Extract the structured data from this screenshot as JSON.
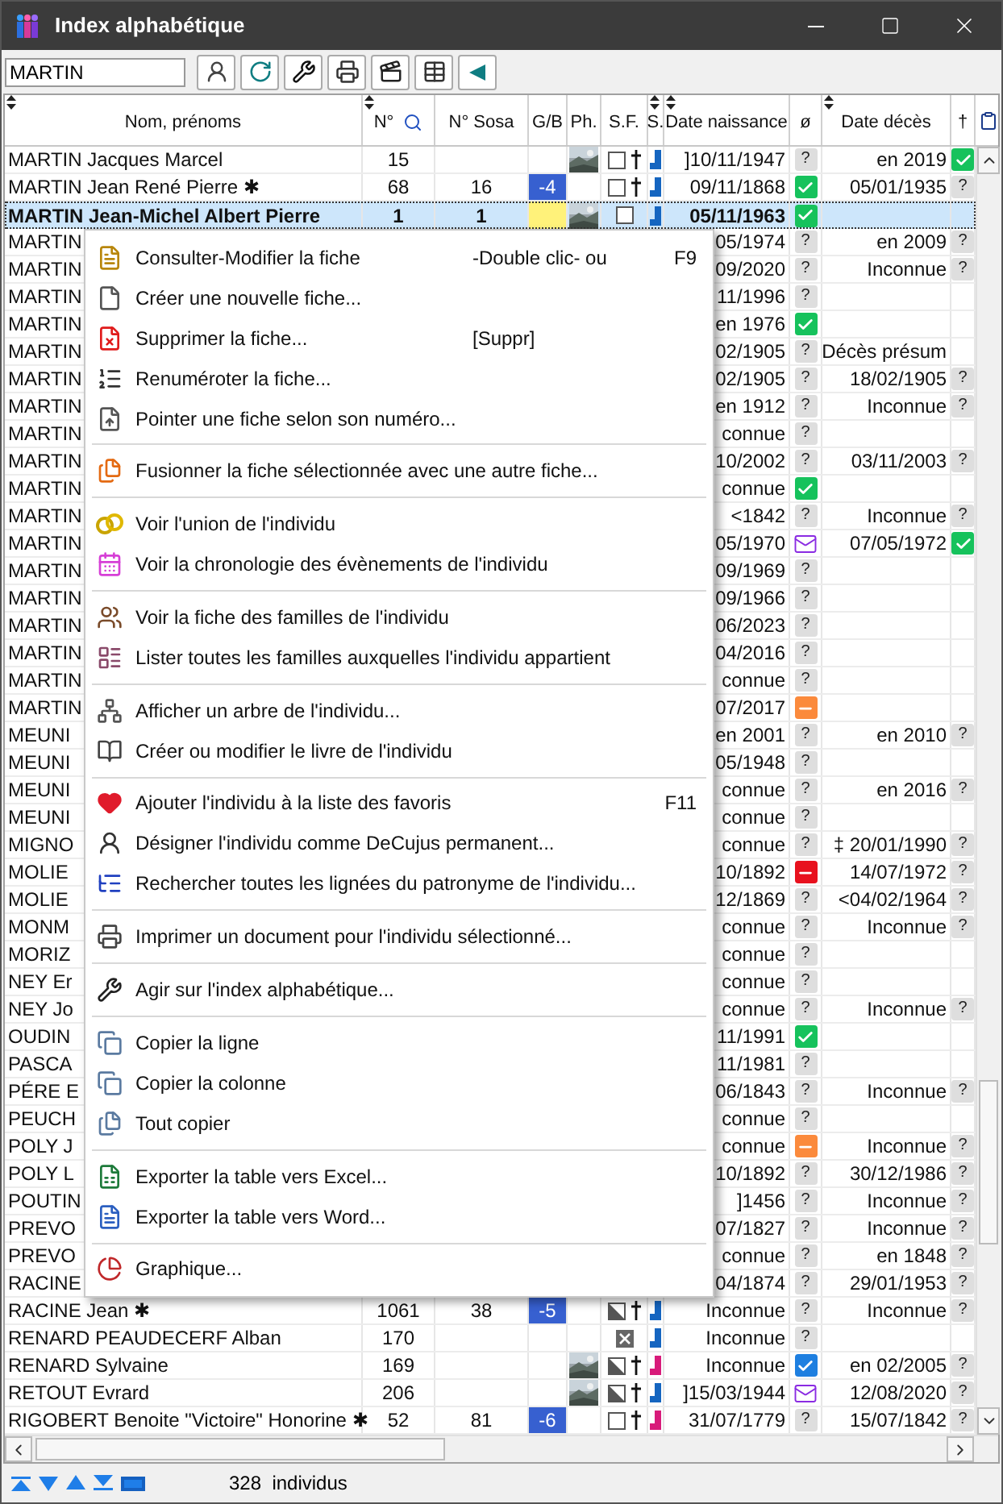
{
  "window": {
    "title": "Index alphabétique"
  },
  "toolbar": {
    "search": {
      "value": "MARTIN"
    }
  },
  "table": {
    "columns": [
      {
        "label": "Nom, prénoms",
        "sort": true
      },
      {
        "label": "N°",
        "sort": true,
        "search": true
      },
      {
        "label": "N° Sosa"
      },
      {
        "label": "G/B"
      },
      {
        "label": "Ph."
      },
      {
        "label": "S.F."
      },
      {
        "label": "S.",
        "sort": true
      },
      {
        "label": "Date naissance",
        "sort": true
      },
      {
        "label": "ø"
      },
      {
        "label": "Date décès",
        "sort": true
      },
      {
        "label": "†"
      }
    ],
    "rows": [
      {
        "selected": false,
        "name": "MARTIN Jacques Marcel",
        "number": "15",
        "sf": {
          "kind": "unchecked"
        },
        "dagger": true,
        "sex": {
          "kind": "male"
        },
        "birth": "]10/11/1947",
        "union": {
          "kind": "unknown",
          "label": "?"
        },
        "death": "en 2019",
        "death_status": {
          "kind": "check"
        }
      },
      {
        "selected": false,
        "name": "MARTIN Jean René Pierre ✱",
        "number": "68",
        "sosa": "16",
        "gb": {
          "kind": "generation",
          "label": "-4"
        },
        "sf": {
          "kind": "unchecked"
        },
        "dagger": true,
        "sex": {
          "kind": "male"
        },
        "birth": "09/11/1868",
        "union": {
          "kind": "check"
        },
        "death": "05/01/1935",
        "death_status": {
          "kind": "unknown",
          "label": "?"
        }
      },
      {
        "selected": true,
        "name": "MARTIN Jean-Michel Albert Pierre",
        "number": "1",
        "sosa": "1",
        "gb": {
          "kind": "self"
        },
        "sf": {
          "kind": "unchecked"
        },
        "sex": {
          "kind": "male"
        },
        "birth": "05/11/1963",
        "union": {
          "kind": "check"
        }
      },
      {
        "selected": false,
        "name": "MARTIN",
        "birth": "05/1974",
        "union": {
          "kind": "unknown",
          "label": "?"
        },
        "death": "en 2009",
        "death_status": {
          "kind": "unknown",
          "label": "?"
        }
      },
      {
        "selected": false,
        "name": "MARTIN",
        "birth": "09/2020",
        "union": {
          "kind": "unknown",
          "label": "?"
        },
        "death": "Inconnue",
        "death_status": {
          "kind": "unknown",
          "label": "?"
        }
      },
      {
        "selected": false,
        "name": "MARTIN",
        "birth": "11/1996",
        "union": {
          "kind": "unknown",
          "label": "?"
        }
      },
      {
        "selected": false,
        "name": "MARTIN",
        "birth": "en 1976",
        "union": {
          "kind": "check"
        }
      },
      {
        "selected": false,
        "name": "MARTIN",
        "birth": "02/1905",
        "union": {
          "kind": "unknown",
          "label": "?"
        },
        "death": "Décès présum"
      },
      {
        "selected": false,
        "name": "MARTIN",
        "birth": "02/1905",
        "union": {
          "kind": "unknown",
          "label": "?"
        },
        "death": "18/02/1905",
        "death_status": {
          "kind": "unknown",
          "label": "?"
        }
      },
      {
        "selected": false,
        "name": "MARTIN",
        "birth": "en 1912",
        "union": {
          "kind": "unknown",
          "label": "?"
        },
        "death": "Inconnue",
        "death_status": {
          "kind": "unknown",
          "label": "?"
        }
      },
      {
        "selected": false,
        "name": "MARTIN",
        "birth": "connue",
        "union": {
          "kind": "unknown",
          "label": "?"
        }
      },
      {
        "selected": false,
        "name": "MARTIN",
        "birth": "10/2002",
        "union": {
          "kind": "unknown",
          "label": "?"
        },
        "death": "03/11/2003",
        "death_status": {
          "kind": "unknown",
          "label": "?"
        }
      },
      {
        "selected": false,
        "name": "MARTIN",
        "birth": "connue",
        "union": {
          "kind": "check"
        }
      },
      {
        "selected": false,
        "name": "MARTIN",
        "birth": "<1842",
        "union": {
          "kind": "unknown",
          "label": "?"
        },
        "death": "Inconnue",
        "death_status": {
          "kind": "unknown",
          "label": "?"
        }
      },
      {
        "selected": false,
        "name": "MARTIN",
        "birth": "05/1970",
        "union": {
          "kind": "letter"
        },
        "death": "07/05/1972",
        "death_status": {
          "kind": "check"
        }
      },
      {
        "selected": false,
        "name": "MARTIN",
        "birth": "09/1969",
        "union": {
          "kind": "unknown",
          "label": "?"
        }
      },
      {
        "selected": false,
        "name": "MARTIN",
        "birth": "09/1966",
        "union": {
          "kind": "unknown",
          "label": "?"
        }
      },
      {
        "selected": false,
        "name": "MARTIN",
        "birth": "06/2023",
        "union": {
          "kind": "unknown",
          "label": "?"
        }
      },
      {
        "selected": false,
        "name": "MARTIN",
        "birth": "04/2016",
        "union": {
          "kind": "unknown",
          "label": "?"
        }
      },
      {
        "selected": false,
        "name": "MARTIN",
        "birth": "connue",
        "union": {
          "kind": "unknown",
          "label": "?"
        }
      },
      {
        "selected": false,
        "name": "MARTIN",
        "birth": "07/2017",
        "union": {
          "kind": "partial"
        }
      },
      {
        "selected": false,
        "name": "MEUNI",
        "birth": "en 2001",
        "union": {
          "kind": "unknown",
          "label": "?"
        },
        "death": "en 2010",
        "death_status": {
          "kind": "unknown",
          "label": "?"
        }
      },
      {
        "selected": false,
        "name": "MEUNI",
        "birth": "05/1948",
        "union": {
          "kind": "unknown",
          "label": "?"
        }
      },
      {
        "selected": false,
        "name": "MEUNI",
        "birth": "connue",
        "union": {
          "kind": "unknown",
          "label": "?"
        },
        "death": "en 2016",
        "death_status": {
          "kind": "unknown",
          "label": "?"
        }
      },
      {
        "selected": false,
        "name": "MEUNI",
        "birth": "connue",
        "union": {
          "kind": "unknown",
          "label": "?"
        }
      },
      {
        "selected": false,
        "name": "MIGNO",
        "birth": "connue",
        "union": {
          "kind": "unknown",
          "label": "?"
        },
        "death": "‡ 20/01/1990",
        "death_status": {
          "kind": "unknown",
          "label": "?"
        }
      },
      {
        "selected": false,
        "name": "MOLIE",
        "birth": "10/1892",
        "union": {
          "kind": "absent"
        },
        "death": "14/07/1972",
        "death_status": {
          "kind": "unknown",
          "label": "?"
        }
      },
      {
        "selected": false,
        "name": "MOLIE",
        "birth": "12/1869",
        "union": {
          "kind": "unknown",
          "label": "?"
        },
        "death": "<04/02/1964",
        "death_status": {
          "kind": "unknown",
          "label": "?"
        }
      },
      {
        "selected": false,
        "name": "MONM",
        "birth": "connue",
        "union": {
          "kind": "unknown",
          "label": "?"
        },
        "death": "Inconnue",
        "death_status": {
          "kind": "unknown",
          "label": "?"
        }
      },
      {
        "selected": false,
        "name": "MORIZ",
        "birth": "connue",
        "union": {
          "kind": "unknown",
          "label": "?"
        }
      },
      {
        "selected": false,
        "name": "NEY Er",
        "birth": "connue",
        "union": {
          "kind": "unknown",
          "label": "?"
        }
      },
      {
        "selected": false,
        "name": "NEY Jo",
        "birth": "connue",
        "union": {
          "kind": "unknown",
          "label": "?"
        },
        "death": "Inconnue",
        "death_status": {
          "kind": "unknown",
          "label": "?"
        }
      },
      {
        "selected": false,
        "name": "OUDIN",
        "birth": "11/1991",
        "union": {
          "kind": "check"
        }
      },
      {
        "selected": false,
        "name": "PASCA",
        "birth": "11/1981",
        "union": {
          "kind": "unknown",
          "label": "?"
        }
      },
      {
        "selected": false,
        "name": "PÉRE E",
        "birth": "06/1843",
        "union": {
          "kind": "unknown",
          "label": "?"
        },
        "death": "Inconnue",
        "death_status": {
          "kind": "unknown",
          "label": "?"
        }
      },
      {
        "selected": false,
        "name": "PEUCH",
        "birth": "connue",
        "union": {
          "kind": "unknown",
          "label": "?"
        }
      },
      {
        "selected": false,
        "name": "POLY J",
        "birth": "connue",
        "union": {
          "kind": "partial"
        },
        "death": "Inconnue",
        "death_status": {
          "kind": "unknown",
          "label": "?"
        }
      },
      {
        "selected": false,
        "name": "POLY L",
        "birth": "10/1892",
        "union": {
          "kind": "unknown",
          "label": "?"
        },
        "death": "30/12/1986",
        "death_status": {
          "kind": "unknown",
          "label": "?"
        }
      },
      {
        "selected": false,
        "name": "POUTIN",
        "birth": "]1456",
        "union": {
          "kind": "unknown",
          "label": "?"
        },
        "death": "Inconnue",
        "death_status": {
          "kind": "unknown",
          "label": "?"
        }
      },
      {
        "selected": false,
        "name": "PREVO",
        "birth": "07/1827",
        "union": {
          "kind": "unknown",
          "label": "?"
        },
        "death": "Inconnue",
        "death_status": {
          "kind": "unknown",
          "label": "?"
        }
      },
      {
        "selected": false,
        "name": "PREVO",
        "birth": "connue",
        "union": {
          "kind": "unknown",
          "label": "?"
        },
        "death": "en 1848",
        "death_status": {
          "kind": "unknown",
          "label": "?"
        }
      },
      {
        "selected": false,
        "name": "RACINE",
        "birth": "04/1874",
        "union": {
          "kind": "unknown",
          "label": "?"
        },
        "death": "29/01/1953",
        "death_status": {
          "kind": "unknown",
          "label": "?"
        }
      },
      {
        "selected": false,
        "name": "RACINE Jean ✱",
        "number": "1061",
        "sosa": "38",
        "gb": {
          "kind": "generation",
          "label": "-5"
        },
        "sf": {
          "kind": "half"
        },
        "dagger": true,
        "sex": {
          "kind": "male"
        },
        "birth": "Inconnue",
        "union": {
          "kind": "unknown",
          "label": "?"
        },
        "death": "Inconnue",
        "death_status": {
          "kind": "unknown",
          "label": "?"
        }
      },
      {
        "selected": false,
        "name": "RENARD PEAUDECERF Alban",
        "number": "170",
        "sf": {
          "kind": "cross"
        },
        "sex": {
          "kind": "male"
        },
        "birth": "Inconnue",
        "union": {
          "kind": "unknown",
          "label": "?"
        }
      },
      {
        "selected": false,
        "name": "RENARD Sylvaine",
        "number": "169",
        "sf": {
          "kind": "half"
        },
        "dagger": true,
        "sex": {
          "kind": "female"
        },
        "birth": "Inconnue",
        "union": {
          "kind": "confirmed"
        },
        "death": "en 02/2005",
        "death_status": {
          "kind": "unknown",
          "label": "?"
        }
      },
      {
        "selected": false,
        "name": "RETOUT Evrard",
        "number": "206",
        "sf": {
          "kind": "half"
        },
        "dagger": true,
        "sex": {
          "kind": "male"
        },
        "birth": "]15/03/1944",
        "union": {
          "kind": "letter"
        },
        "death": "12/08/2020",
        "death_status": {
          "kind": "unknown",
          "label": "?"
        }
      },
      {
        "selected": false,
        "name": "RIGOBERT Benoite \"Victoire\" Honorine ✱",
        "number": "52",
        "sosa": "81",
        "gb": {
          "kind": "generation",
          "label": "-6"
        },
        "sf": {
          "kind": "unchecked"
        },
        "dagger": true,
        "sex": {
          "kind": "female"
        },
        "birth": "31/07/1779",
        "union": {
          "kind": "unknown",
          "label": "?"
        },
        "death": "15/07/1842",
        "death_status": {
          "kind": "unknown",
          "label": "?"
        }
      }
    ]
  },
  "context_menu": {
    "groups": [
      [
        {
          "label": "Consulter-Modifier la fiche",
          "hint": "-Double clic- ou",
          "shortcut": "F9"
        },
        {
          "label": "Créer une nouvelle fiche..."
        },
        {
          "label": "Supprimer la fiche...",
          "hint": "[Suppr]"
        },
        {
          "label": "Renuméroter la fiche..."
        },
        {
          "label": "Pointer une fiche selon son numéro..."
        }
      ],
      [
        {
          "label": "Fusionner la fiche sélectionnée avec une autre fiche..."
        }
      ],
      [
        {
          "label": "Voir l'union de l'individu"
        },
        {
          "label": "Voir la chronologie des évènements de l'individu"
        }
      ],
      [
        {
          "label": "Voir la fiche des familles de l'individu"
        },
        {
          "label": "Lister toutes les familles auxquelles l'individu appartient"
        }
      ],
      [
        {
          "label": "Afficher un arbre de l'individu..."
        },
        {
          "label": "Créer ou modifier le livre de l'individu"
        }
      ],
      [
        {
          "label": "Ajouter l'individu à la liste des favoris",
          "shortcut": "F11"
        },
        {
          "label": "Désigner l'individu comme DeCujus permanent..."
        },
        {
          "label": "Rechercher toutes les lignées du patronyme de l'individu..."
        }
      ],
      [
        {
          "label": "Imprimer un document pour l'individu sélectionné..."
        }
      ],
      [
        {
          "label": "Agir sur l'index alphabétique..."
        }
      ],
      [
        {
          "label": "Copier la ligne"
        },
        {
          "label": "Copier la colonne"
        },
        {
          "label": "Tout copier"
        }
      ],
      [
        {
          "label": "Exporter la table vers Excel..."
        },
        {
          "label": "Exporter la table vers Word..."
        }
      ],
      [
        {
          "label": "Graphique..."
        }
      ]
    ]
  },
  "status_bar": {
    "count": "328  individus"
  }
}
